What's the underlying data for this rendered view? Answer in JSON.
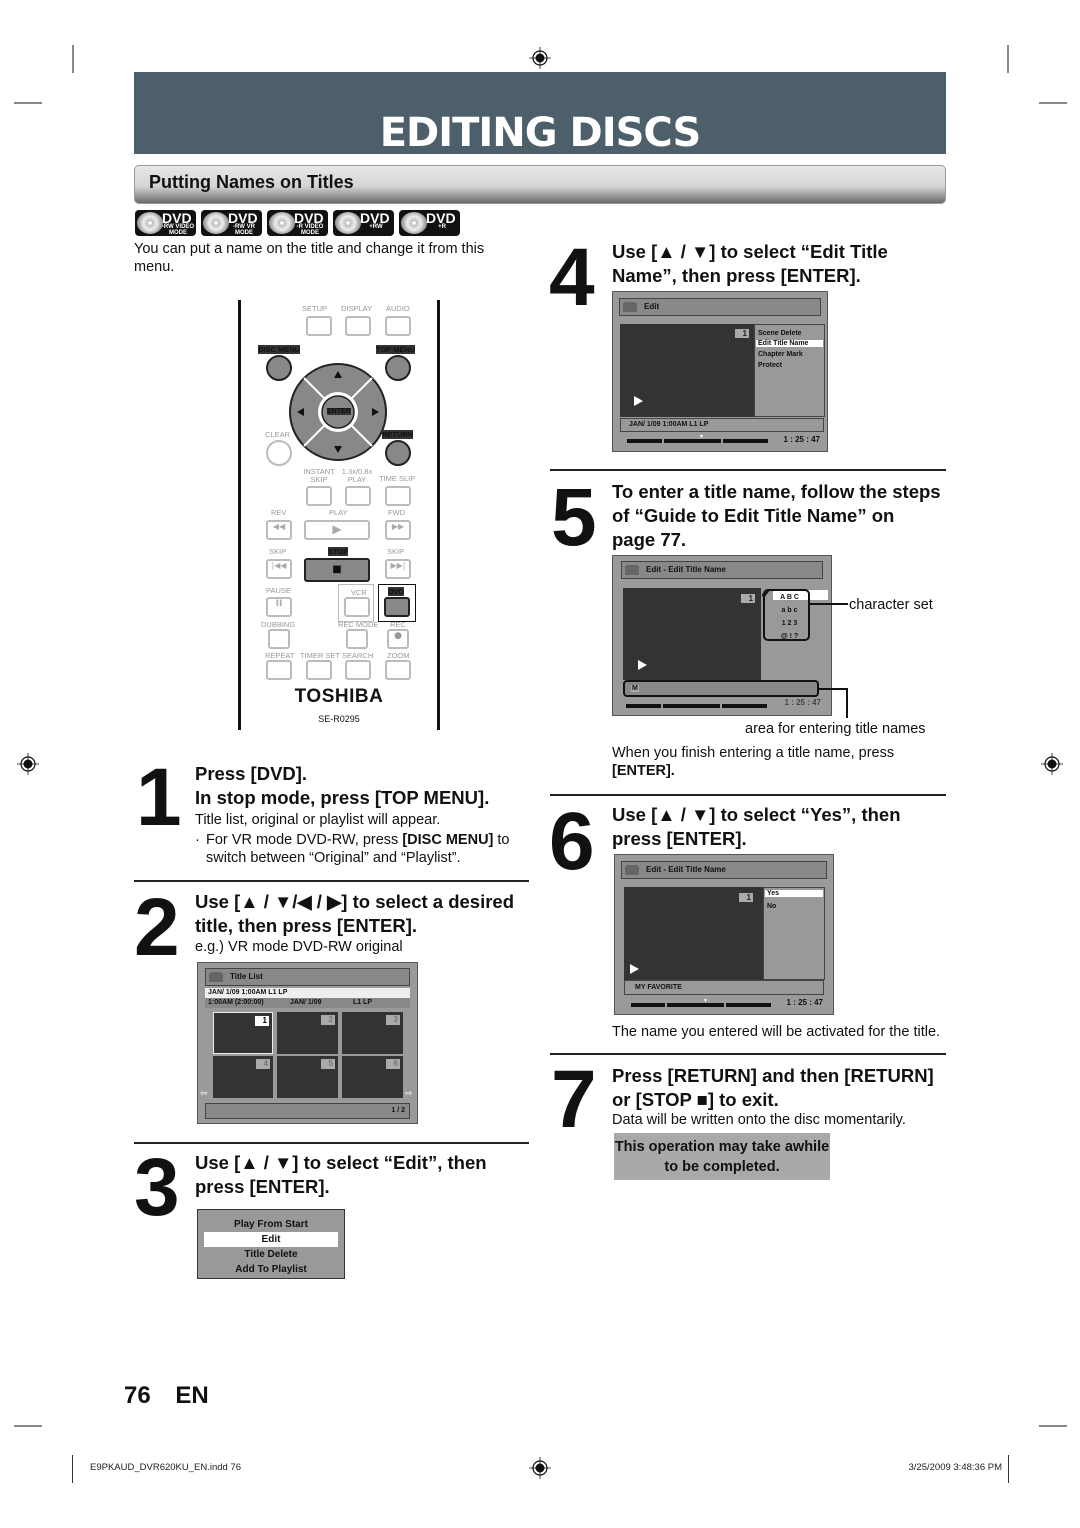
{
  "header": {
    "title": "EDITING DISCS",
    "section": "Putting Names on Titles"
  },
  "disc_badges": [
    {
      "icon": "dvd-rw-video-mode-icon",
      "label": "DVD",
      "sub": "-RW VIDEO MODE"
    },
    {
      "icon": "dvd-rw-vr-mode-icon",
      "label": "DVD",
      "sub": "-RW VR MODE"
    },
    {
      "icon": "dvd-r-video-mode-icon",
      "label": "DVD",
      "sub": "-R VIDEO MODE"
    },
    {
      "icon": "dvd-plus-rw-icon",
      "label": "DVD",
      "sub": "+RW"
    },
    {
      "icon": "dvd-plus-r-icon",
      "label": "DVD",
      "sub": "+R"
    }
  ],
  "intro": "You can put a name on the title and change it from this menu.",
  "remote": {
    "labels": {
      "setup": "SETUP",
      "display": "DISPLAY",
      "audio": "AUDIO",
      "disc_menu": "DISC MENU",
      "top_menu": "TOP MENU",
      "enter": "ENTER",
      "clear": "CLEAR",
      "return": "RETURN",
      "instant_skip": "INSTANT SKIP",
      "play_speed": "1.3x/0.8x PLAY",
      "time_slip": "TIME SLIP",
      "rev": "REV",
      "play": "PLAY",
      "fwd": "FWD",
      "skip_back": "SKIP",
      "stop": "STOP",
      "skip_fwd": "SKIP",
      "pause": "PAUSE",
      "vcr": "VCR",
      "dvd": "DVD",
      "dubbing": "DUBBING",
      "rec_mode": "REC MODE",
      "rec": "REC",
      "repeat": "REPEAT",
      "timer_set": "TIMER SET",
      "search": "SEARCH",
      "zoom": "ZOOM"
    },
    "brand": "TOSHIBA",
    "model": "SE-R0295"
  },
  "steps": [
    {
      "number": "1",
      "heading_line1": "Press [DVD].",
      "heading_line2": "In stop mode, press [TOP MENU].",
      "text": "Title list, original or playlist will appear.",
      "bullet_pre": "For VR mode DVD-RW, press ",
      "bullet_bold": "[DISC MENU]",
      "bullet_post": " to switch between “Original” and “Playlist”."
    },
    {
      "number": "2",
      "heading": "Use [▲ / ▼/◀ / ▶] to select a desired title, then press [ENTER].",
      "text": "e.g.) VR mode DVD-RW original",
      "screen": {
        "title": "Title List",
        "info_line1": "JAN/ 1/09 1:00AM  L1   LP",
        "info_line2_a": "1:00AM (2:00:00)",
        "info_line2_b": "JAN/ 1/09",
        "info_line2_c": "L1   LP",
        "thumbs": [
          "1",
          "2",
          "3",
          "4",
          "5",
          "6"
        ],
        "selected": "1",
        "page": "1 / 2"
      }
    },
    {
      "number": "3",
      "heading": "Use [▲ / ▼] to select “Edit”, then press [ENTER].",
      "menu": [
        "Play From Start",
        "Edit",
        "Title Delete",
        "Add To Playlist"
      ],
      "selected": "Edit"
    },
    {
      "number": "4",
      "heading": "Use [▲ / ▼] to select “Edit Title Name”, then press [ENTER].",
      "screen": {
        "title": "Edit",
        "title_number": "1",
        "menu": [
          "Scene Delete",
          "Edit Title Name",
          "Chapter Mark",
          "Protect"
        ],
        "selected": "Edit Title Name",
        "info": "JAN/ 1/09 1:00AM L1   LP",
        "timecode": "1 : 25 : 47"
      }
    },
    {
      "number": "5",
      "heading": "To enter a title name, follow the steps of “Guide to Edit Title Name” on page 77.",
      "screen": {
        "title": "Edit - Edit Title Name",
        "title_number": "1",
        "charsets": [
          "A  B  C",
          "a  b  c",
          "1  2  3",
          "@  !  ?"
        ],
        "selected": "A  B  C",
        "entry": "M",
        "timecode": "1 : 25 : 47"
      },
      "callout_charset": "character set",
      "callout_entry": "area for entering title names",
      "text_pre": "When you finish entering a title name, press",
      "text_bold": "[ENTER]."
    },
    {
      "number": "6",
      "heading": "Use [▲ / ▼] to select “Yes”, then press [ENTER].",
      "screen": {
        "title": "Edit - Edit Title Name",
        "title_number": "1",
        "menu": [
          "Yes",
          "No"
        ],
        "selected": "Yes",
        "name": "MY FAVORITE",
        "timecode": "1 : 25 : 47"
      },
      "text": "The name you entered will be activated for the title."
    },
    {
      "number": "7",
      "heading": "Press [RETURN] and then [RETURN] or [STOP ■] to exit.",
      "text": "Data will be written onto the disc momentarily.",
      "note": "This operation may take awhile to be completed."
    }
  ],
  "page": {
    "number": "76",
    "lang": "EN"
  },
  "footer": {
    "file": "E9PKAUD_DVR620KU_EN.indd  76",
    "datetime": "3/25/2009   3:48:36 PM"
  }
}
